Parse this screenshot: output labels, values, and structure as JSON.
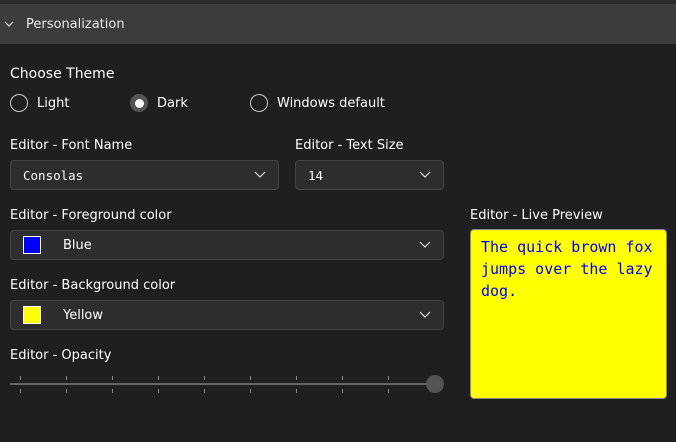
{
  "section": {
    "title": "Personalization"
  },
  "theme": {
    "label": "Choose Theme",
    "options": [
      "Light",
      "Dark",
      "Windows default"
    ],
    "selected": "Dark"
  },
  "font_name": {
    "label": "Editor - Font Name",
    "value": "Consolas"
  },
  "text_size": {
    "label": "Editor - Text Size",
    "value": "14"
  },
  "foreground": {
    "label": "Editor - Foreground color",
    "value": "Blue",
    "color": "#0000ff"
  },
  "background": {
    "label": "Editor - Background color",
    "value": "Yellow",
    "color": "#ffff00"
  },
  "opacity": {
    "label": "Editor - Opacity",
    "value": 1.0
  },
  "preview": {
    "label": "Editor - Live Preview",
    "text": "The quick brown fox jumps over the lazy dog."
  }
}
